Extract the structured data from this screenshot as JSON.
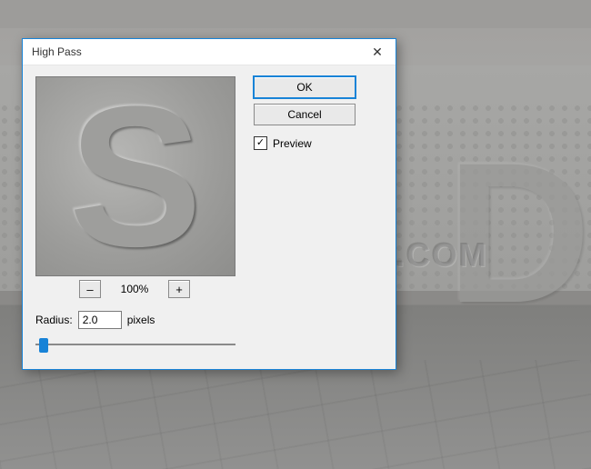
{
  "dialog": {
    "title": "High Pass",
    "close_glyph": "✕",
    "ok_label": "OK",
    "cancel_label": "Cancel",
    "preview_label": "Preview",
    "preview_checked": true,
    "zoom_minus": "–",
    "zoom_plus": "+",
    "zoom_percent": "100%",
    "radius_label": "Radius:",
    "radius_value": "2.0",
    "radius_unit": "pixels",
    "preview_letter": "S"
  },
  "background": {
    "watermark_text": "WWW.PSD-DUDE.COM",
    "big_letters": "D"
  }
}
